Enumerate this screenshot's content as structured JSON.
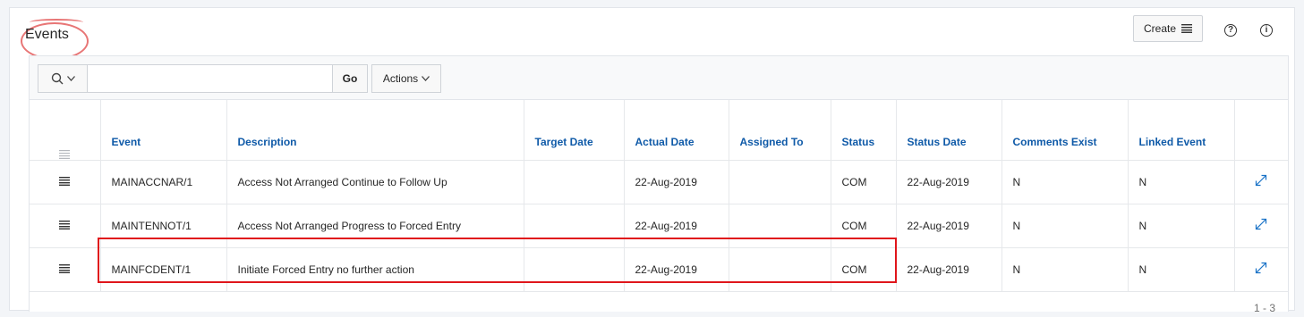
{
  "region": {
    "title": "Events",
    "create_label": "Create",
    "help_icon": "question-circle-icon",
    "info_icon": "info-circle-icon"
  },
  "toolbar": {
    "search_value": "",
    "search_placeholder": "",
    "go_label": "Go",
    "actions_label": "Actions"
  },
  "table": {
    "columns": [
      "Event",
      "Description",
      "Target Date",
      "Actual Date",
      "Assigned To",
      "Status",
      "Status Date",
      "Comments Exist",
      "Linked Event"
    ],
    "rows": [
      {
        "event": "MAINACCNAR/1",
        "description": "Access Not Arranged Continue to Follow Up",
        "target_date": "",
        "actual_date": "22-Aug-2019",
        "assigned_to": "",
        "status": "COM",
        "status_date": "22-Aug-2019",
        "comments_exist": "N",
        "linked_event": "N"
      },
      {
        "event": "MAINTENNOT/1",
        "description": "Access Not Arranged Progress to Forced Entry",
        "target_date": "",
        "actual_date": "22-Aug-2019",
        "assigned_to": "",
        "status": "COM",
        "status_date": "22-Aug-2019",
        "comments_exist": "N",
        "linked_event": "N"
      },
      {
        "event": "MAINFCDENT/1",
        "description": "Initiate Forced Entry no further action",
        "target_date": "",
        "actual_date": "22-Aug-2019",
        "assigned_to": "",
        "status": "COM",
        "status_date": "22-Aug-2019",
        "comments_exist": "N",
        "linked_event": "N"
      }
    ]
  },
  "pagination": "1 - 3",
  "colors": {
    "header_link": "#0f5aa8",
    "annotation_red": "#e0161b",
    "annotation_oval": "#e87676"
  }
}
